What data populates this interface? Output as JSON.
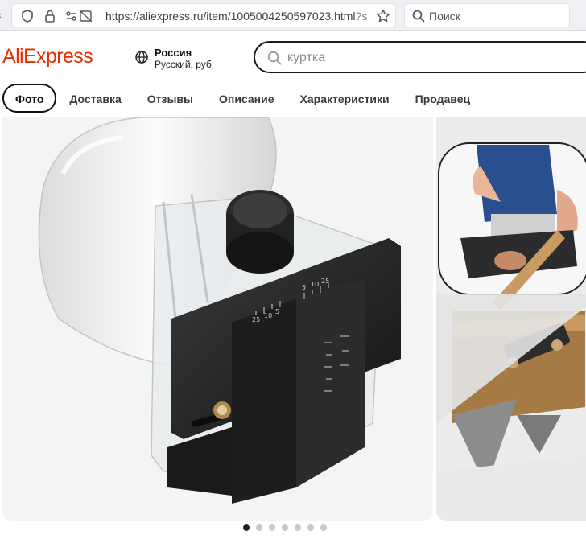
{
  "browser": {
    "url_main": "https://aliexpress.ru/item/1005004250597023.html",
    "url_tail": "?s",
    "search_placeholder": "Поиск"
  },
  "header": {
    "logo": "AliExpress",
    "region_name": "Россия",
    "region_sub": "Русский, руб.",
    "search_placeholder": "куртка"
  },
  "tabs": [
    {
      "label": "Фото",
      "active": true
    },
    {
      "label": "Доставка",
      "active": false
    },
    {
      "label": "Отзывы",
      "active": false
    },
    {
      "label": "Описание",
      "active": false
    },
    {
      "label": "Характеристики",
      "active": false
    },
    {
      "label": "Продавец",
      "active": false
    }
  ],
  "gallery": {
    "slide_count": 7,
    "active_slide": 1,
    "ruler_labels": [
      "25",
      "10",
      "5",
      "5",
      "10",
      "25"
    ]
  },
  "colors": {
    "brand": "#e62e04",
    "active_dot": "#222222",
    "inactive_dot": "#c8c8c8"
  },
  "icons": [
    "shield-icon",
    "lock-icon",
    "permissions-icon",
    "star-icon",
    "search-icon",
    "globe-icon"
  ]
}
